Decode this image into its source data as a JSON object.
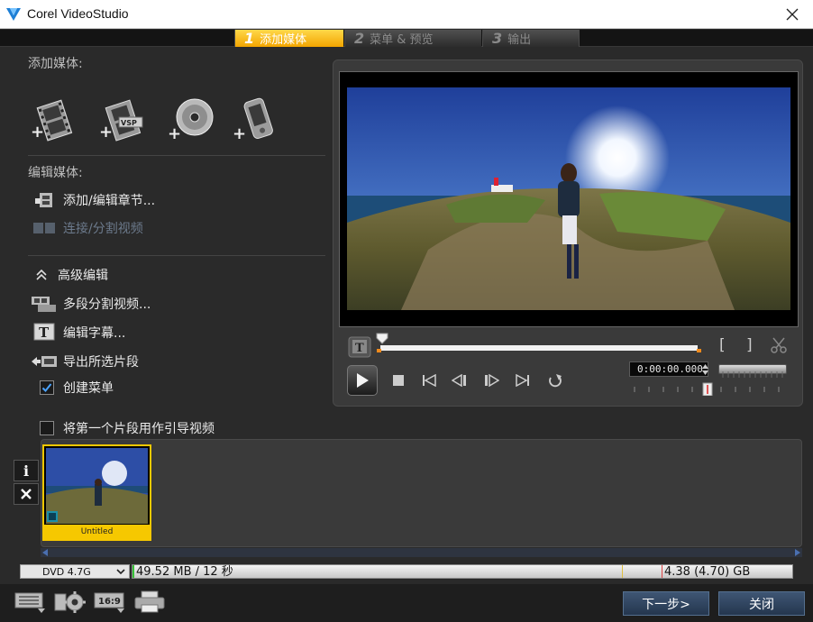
{
  "window": {
    "title": "Corel VideoStudio",
    "close_glyph": "✕"
  },
  "steps": [
    {
      "num": "1",
      "label": "添加媒体",
      "active": true
    },
    {
      "num": "2",
      "label": "菜单 & 预览",
      "active": false
    },
    {
      "num": "3",
      "label": "输出",
      "active": false
    }
  ],
  "add_media": {
    "title": "添加媒体:",
    "icons": [
      "add-video-icon",
      "add-vsp-project-icon",
      "add-disc-icon",
      "add-mobile-device-icon"
    ],
    "vsp_label": "VSP"
  },
  "edit_media": {
    "title": "编辑媒体:",
    "add_edit_chapters": "添加/编辑章节...",
    "join_split_video": "连接/分割视频"
  },
  "advanced": {
    "title": "高级编辑",
    "multi_trim": "多段分割视频...",
    "edit_subtitles": "编辑字幕...",
    "export_clips": "导出所选片段",
    "create_menu": "创建菜单",
    "create_menu_checked": true,
    "intro_video": "将第一个片段用作引导视频",
    "intro_video_checked": false
  },
  "preview": {
    "timecode": "0:00:00.000",
    "mark_in": "[",
    "mark_out": "]"
  },
  "clips": [
    {
      "label": "Untitled"
    }
  ],
  "side_buttons": {
    "info": "i"
  },
  "disc": {
    "type": "DVD 4.7G",
    "used": "49.52 MB / 12 秒",
    "capacity": "4.38 (4.70) GB",
    "used_fraction": 0.011
  },
  "buttons": {
    "next": "下一步>",
    "close": "关闭"
  },
  "colors": {
    "accent": "#f6c800",
    "button": "#2f4562"
  }
}
